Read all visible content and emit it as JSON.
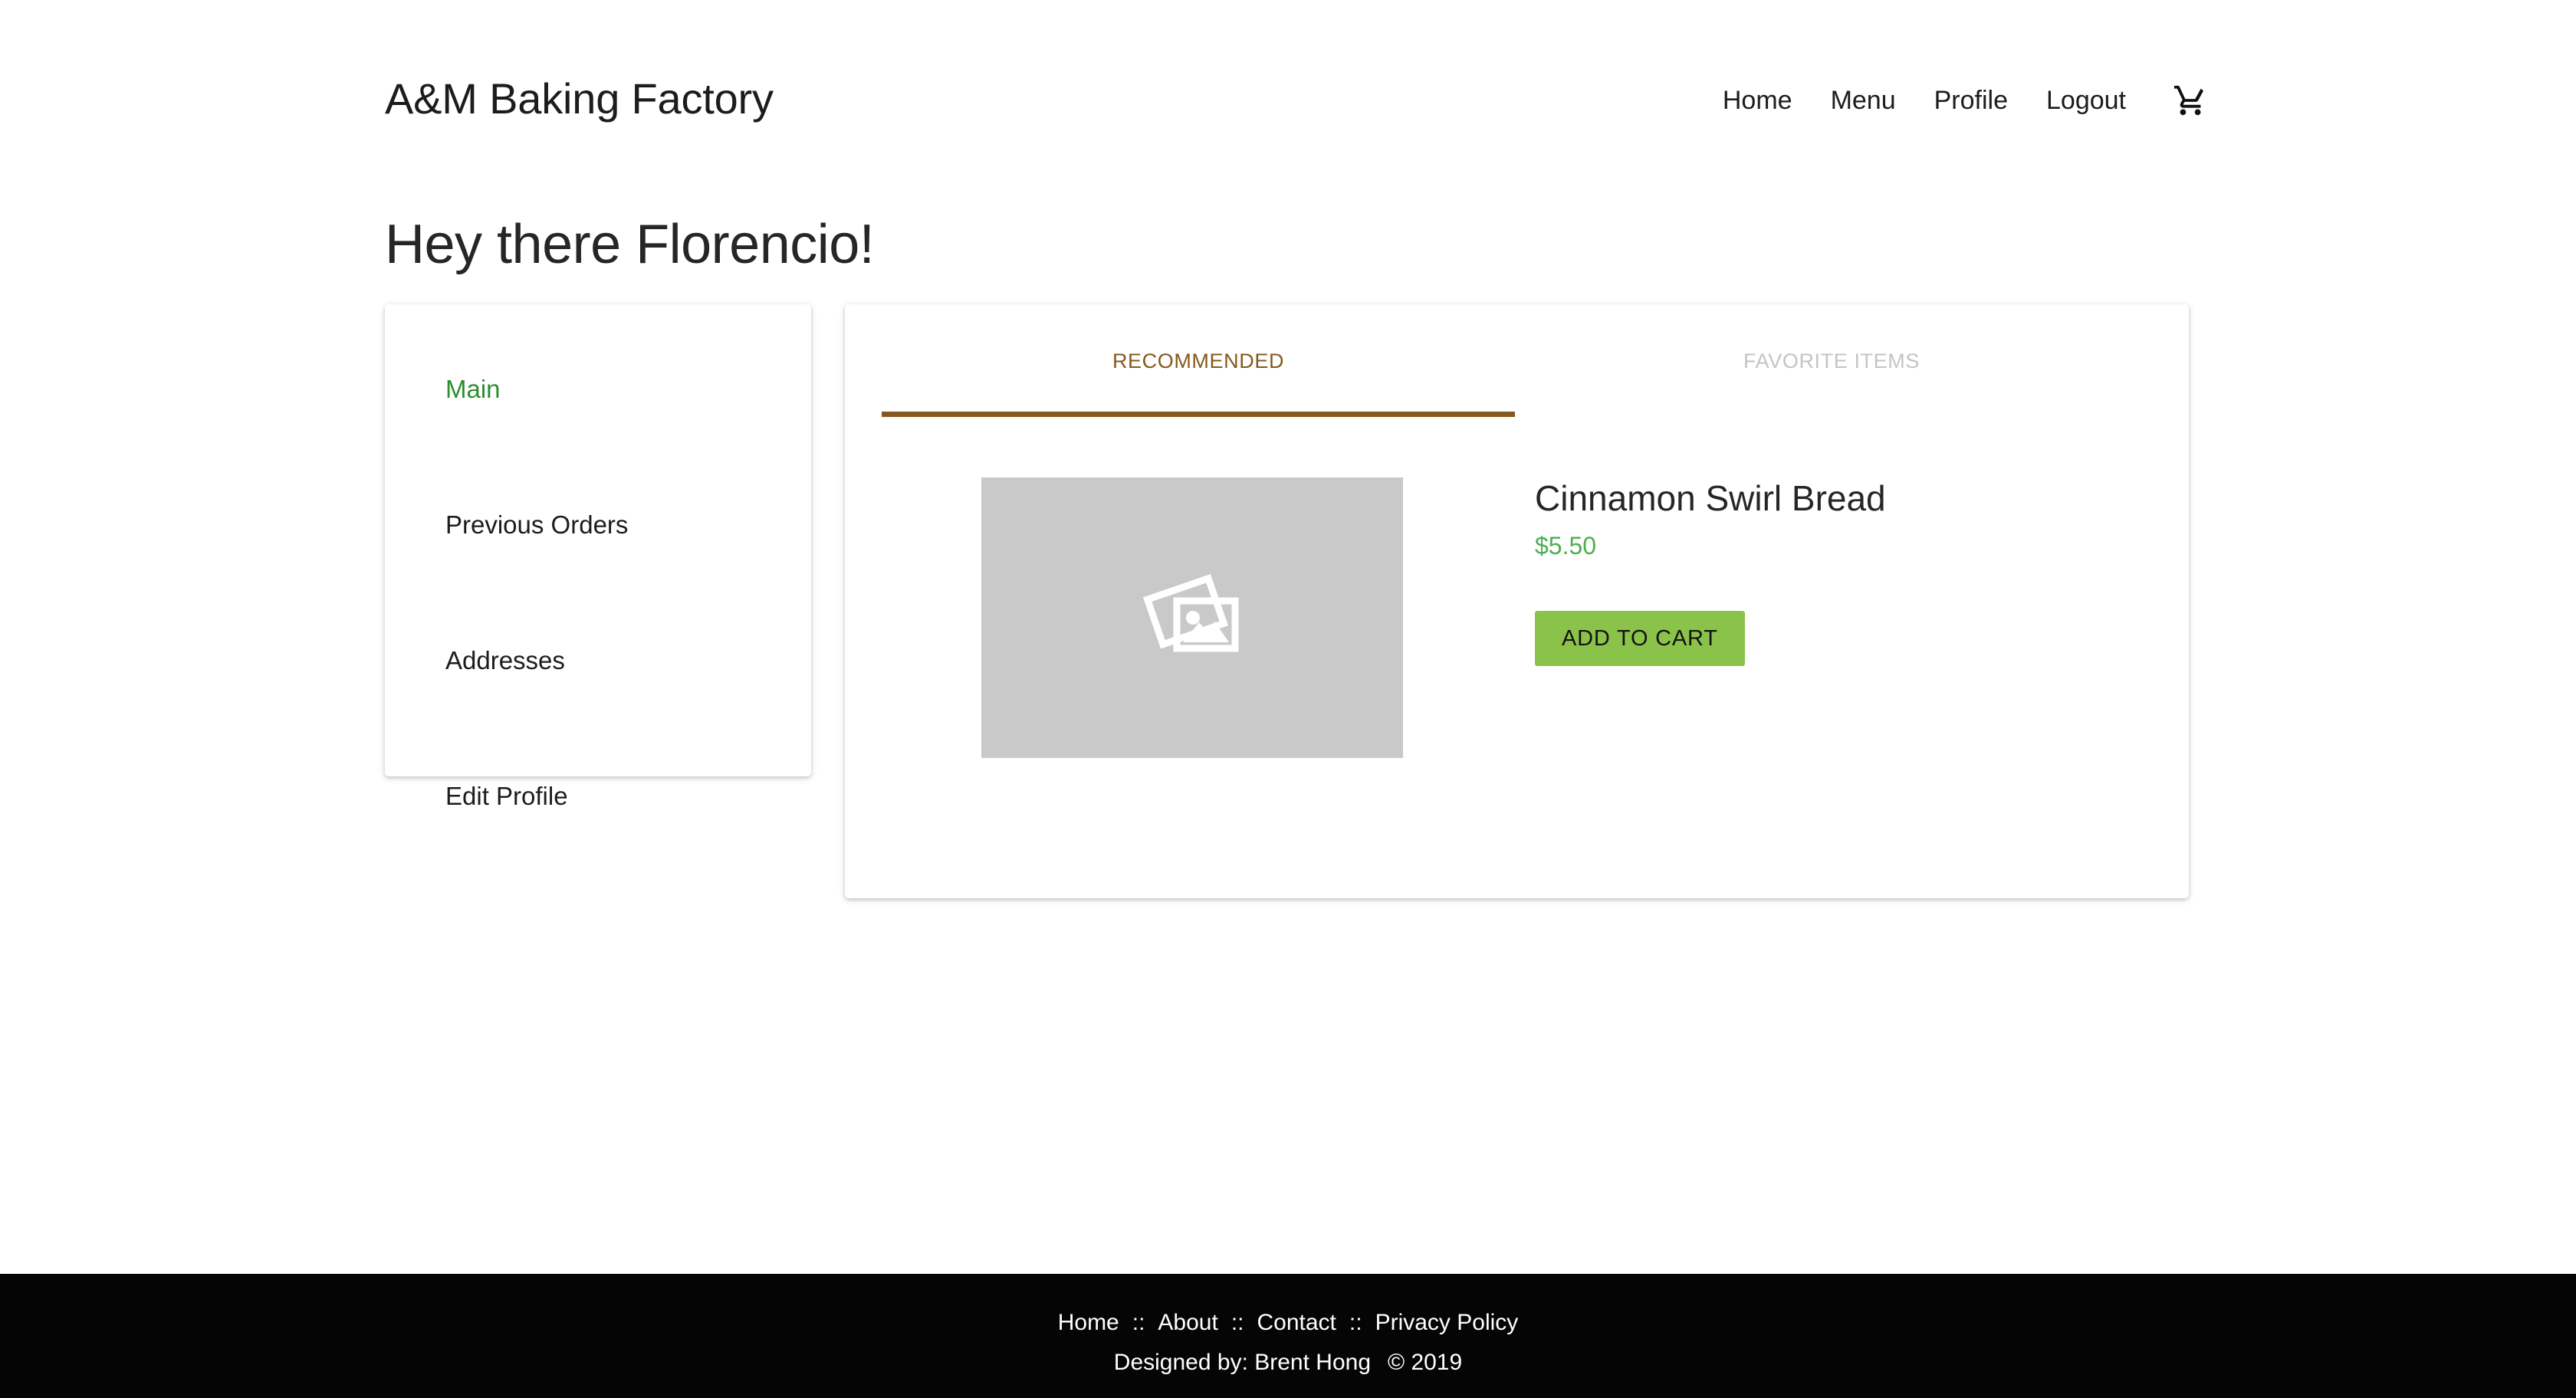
{
  "header": {
    "brand": "A&M Baking Factory",
    "nav": [
      {
        "label": "Home"
      },
      {
        "label": "Menu"
      },
      {
        "label": "Profile"
      },
      {
        "label": "Logout"
      }
    ],
    "cart_icon": "shopping-cart-icon"
  },
  "greeting": "Hey there Florencio!",
  "sidebar": {
    "items": [
      {
        "label": "Main",
        "active": true
      },
      {
        "label": "Previous Orders",
        "active": false
      },
      {
        "label": "Addresses",
        "active": false
      },
      {
        "label": "Edit Profile",
        "active": false
      }
    ]
  },
  "tabs": [
    {
      "label": "RECOMMENDED",
      "active": true
    },
    {
      "label": "FAVORITE ITEMS",
      "active": false
    }
  ],
  "product": {
    "image_placeholder_icon": "image-placeholder-icon",
    "title": "Cinnamon Swirl Bread",
    "price": "$5.50",
    "add_to_cart_label": "ADD TO CART"
  },
  "footer": {
    "links": [
      {
        "label": "Home"
      },
      {
        "label": "About"
      },
      {
        "label": "Contact"
      },
      {
        "label": "Privacy Policy"
      }
    ],
    "separator": "::",
    "credit": "Designed by: Brent Hong",
    "copyright": "© 2019"
  },
  "colors": {
    "active_link_green": "#2b8f2e",
    "price_green": "#4caf50",
    "button_green": "#8bc34a",
    "tab_brown": "#85591d",
    "inactive_tab_grey": "#c4c4c4",
    "placeholder_grey": "#c9c9c9",
    "footer_black": "#050505"
  }
}
